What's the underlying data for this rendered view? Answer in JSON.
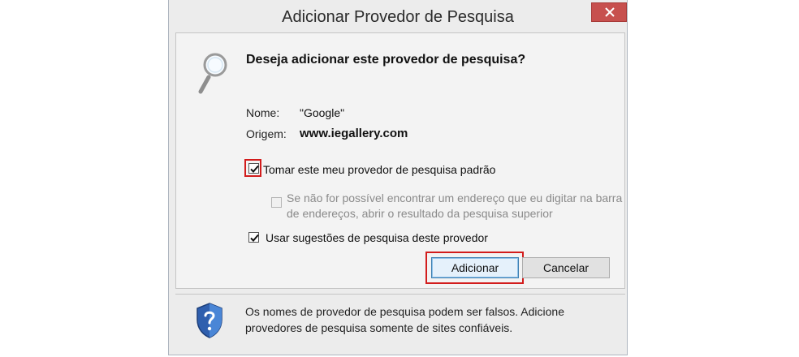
{
  "dialog": {
    "title": "Adicionar Provedor de Pesquisa",
    "close_icon": "close-icon",
    "question": "Deseja adicionar este provedor de pesquisa?",
    "name_label": "Nome:",
    "name_value": "\"Google\"",
    "origin_label": "Origem:",
    "origin_value": "www.iegallery.com",
    "checkbox_default": {
      "label": "Tomar este meu provedor de pesquisa padrão",
      "checked": true
    },
    "checkbox_address": {
      "label": "Se não for possível encontrar um endereço que eu digitar na barra de endereços, abrir o resultado da pesquisa superior",
      "checked": false,
      "disabled": true
    },
    "checkbox_suggestions": {
      "label": "Usar sugestões de pesquisa deste provedor",
      "checked": true
    },
    "add_button": "Adicionar",
    "cancel_button": "Cancelar",
    "warning": "Os nomes de provedor de pesquisa podem ser falsos. Adicione provedores de pesquisa somente de sites confiáveis.",
    "colors": {
      "highlight": "#d21c1c",
      "close": "#c7504e",
      "accent": "#3c7fb1"
    }
  }
}
